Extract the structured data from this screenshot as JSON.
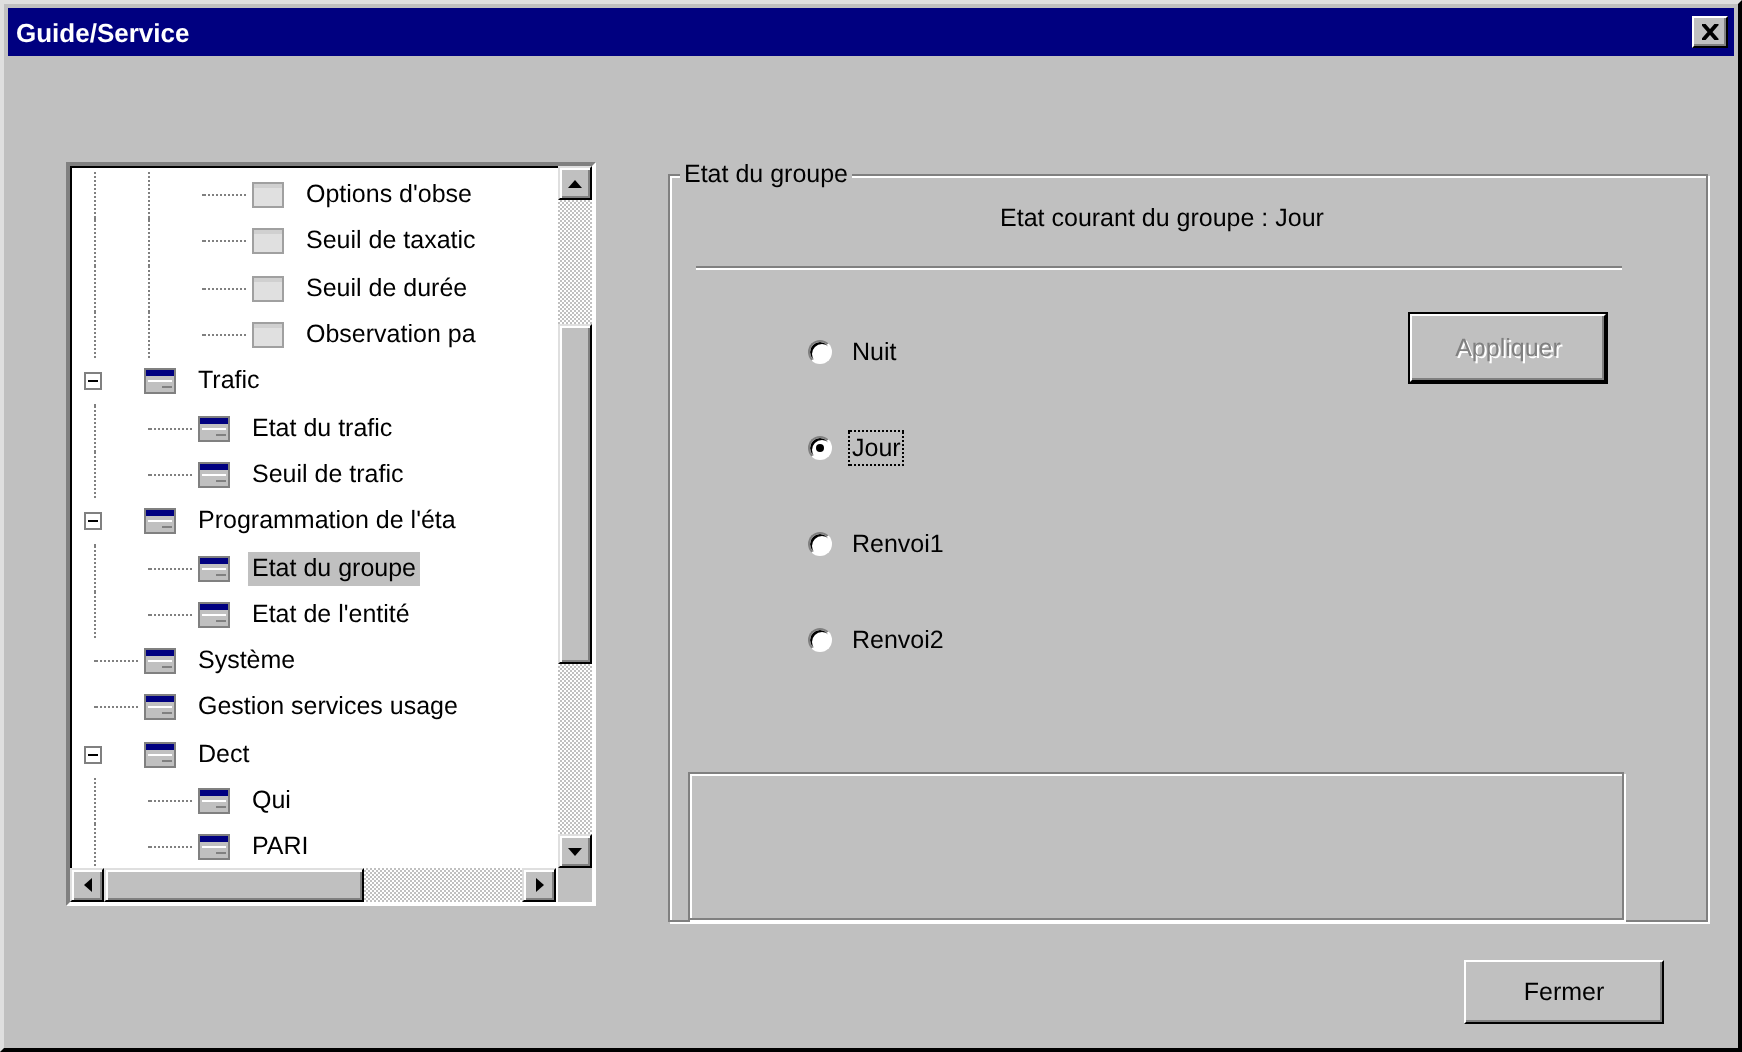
{
  "window": {
    "title": "Guide/Service"
  },
  "tree": {
    "items": [
      {
        "children": [
          {
            "children": [
              {
                "label": "Options d'obse",
                "disabled": true,
                "selected": false
              },
              {
                "label": "Seuil de taxatic",
                "disabled": true,
                "selected": false
              },
              {
                "label": "Seuil de durée",
                "disabled": true,
                "selected": false
              },
              {
                "label": "Observation pa",
                "disabled": true,
                "selected": false
              }
            ]
          }
        ]
      },
      {
        "label": "Trafic",
        "disabled": false,
        "selected": false,
        "expanded": true,
        "children": [
          {
            "label": "Etat du trafic",
            "disabled": false,
            "selected": false
          },
          {
            "label": "Seuil de trafic",
            "disabled": false,
            "selected": false
          }
        ]
      },
      {
        "label": "Programmation de l'éta",
        "disabled": false,
        "selected": false,
        "expanded": true,
        "children": [
          {
            "label": "Etat du groupe",
            "disabled": false,
            "selected": true
          },
          {
            "label": "Etat de l'entité",
            "disabled": false,
            "selected": false
          }
        ]
      },
      {
        "label": "Système",
        "disabled": false,
        "selected": false
      },
      {
        "label": "Gestion services usage",
        "disabled": false,
        "selected": false
      },
      {
        "label": "Dect",
        "disabled": false,
        "selected": false,
        "expanded": true,
        "children": [
          {
            "label": "Qui",
            "disabled": false,
            "selected": false
          },
          {
            "label": "PARI",
            "disabled": false,
            "selected": false
          }
        ]
      }
    ]
  },
  "group": {
    "title": "Etat du groupe",
    "current_state": "Etat courant du groupe : Jour",
    "options": [
      {
        "label": "Nuit",
        "selected": false,
        "focused": false
      },
      {
        "label": "Jour",
        "selected": true,
        "focused": true
      },
      {
        "label": "Renvoi1",
        "selected": false,
        "focused": false
      },
      {
        "label": "Renvoi2",
        "selected": false,
        "focused": false
      }
    ],
    "apply_button": {
      "label": "Appliquer",
      "disabled": true
    }
  },
  "buttons": [
    {
      "label": "Fermer"
    }
  ]
}
